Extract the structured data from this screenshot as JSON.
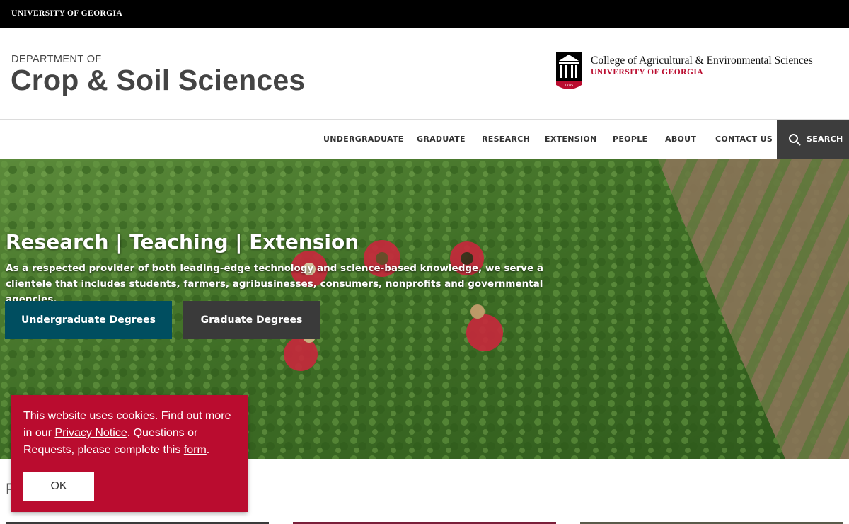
{
  "topbar": {
    "university": "UNIVERSITY OF GEORGIA"
  },
  "masthead": {
    "department_prefix": "DEPARTMENT OF",
    "department_name": "Crop & Soil Sciences",
    "college_name": "College of Agricultural & Environmental Sciences",
    "college_university": "UNIVERSITY OF GEORGIA",
    "logo_year": "1785"
  },
  "nav": {
    "items": [
      {
        "label": "UNDERGRADUATE"
      },
      {
        "label": "GRADUATE"
      },
      {
        "label": "RESEARCH"
      },
      {
        "label": "EXTENSION"
      },
      {
        "label": "PEOPLE"
      },
      {
        "label": "ABOUT"
      },
      {
        "label": "CONTACT US"
      }
    ],
    "search_label": "SEARCH"
  },
  "hero": {
    "title": "Research | Teaching | Extension",
    "text": "As a respected provider of both leading-edge technology and science-based knowledge, we serve a clientele that includes students, farmers, agribusinesses, consumers, nonprofits and governmental agencies.",
    "buttons": {
      "undergraduate": "Undergraduate Degrees",
      "graduate": "Graduate Degrees"
    }
  },
  "below": {
    "heading_partial": "F"
  },
  "cookie": {
    "text_before_privacy": "This website uses cookies. Find out more in our ",
    "privacy_link": "Privacy Notice",
    "text_between": ". Questions or Requests, please complete this ",
    "form_link": "form",
    "text_end": ".",
    "ok_label": "OK"
  },
  "colors": {
    "uga_red": "#ba0c2f",
    "undergrad_button": "#004e60",
    "grad_button": "#3a3a3a",
    "search_bg": "#3d3d3d"
  }
}
